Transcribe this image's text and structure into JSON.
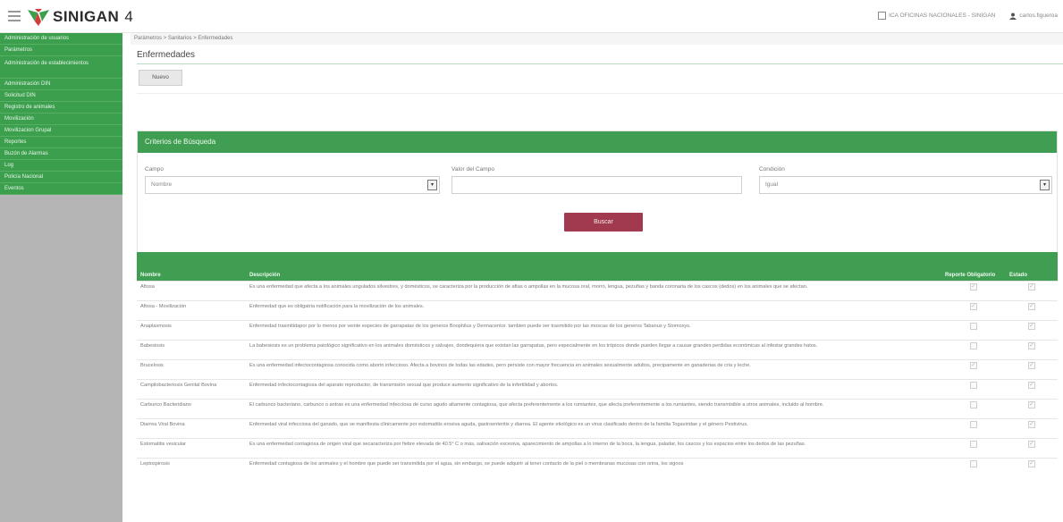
{
  "header": {
    "app_name": "SINIGAN",
    "version": "4",
    "office_label": "ICA OFICINAS NACIONALES - SINIGAN",
    "user_label": "carlos.figueroa"
  },
  "sidebar": {
    "items": [
      {
        "label": "Administración de usuarios"
      },
      {
        "label": "Parámetros"
      },
      {
        "label": "Administración de establecimientos"
      },
      {
        "label": "Administración DIN"
      },
      {
        "label": "Solicitud DIN"
      },
      {
        "label": "Registro de animales"
      },
      {
        "label": "Movilización"
      },
      {
        "label": "Movilizacion Grupal"
      },
      {
        "label": "Reportes"
      },
      {
        "label": "Buzón de Alarmas"
      },
      {
        "label": "Log"
      },
      {
        "label": "Policía Nacional"
      },
      {
        "label": "Eventos"
      }
    ]
  },
  "breadcrumb": "Parámetros > Sanitarios > Enfermedades",
  "page": {
    "title": "Enfermedades",
    "new_button": "Nuevo"
  },
  "criteria": {
    "title": "Criterios de Búsqueda",
    "field_label": "Campo",
    "field_value": "Nombre",
    "value_label": "Valor del Campo",
    "value_value": "",
    "condition_label": "Condición",
    "condition_value": "Igual",
    "search_button": "Buscar"
  },
  "table": {
    "headers": {
      "name": "Nombre",
      "description": "Descripción",
      "mandatory": "Reporte Obligatorio",
      "status": "Estado"
    },
    "rows": [
      {
        "name": "Aftosa",
        "description": "Es una enfermedad que afecta a los animales ungulados silvestres, y domésticos, se caracteriza por la producción de aftas o ampollas en la mucosa oral, morro, lengua, pezuñas y banda coronaria de los cascos (dedos) en los animales que se afectan.",
        "mandatory": true,
        "status": true
      },
      {
        "name": "Aftosa - Movilización",
        "description": "Enfermedad que es obligatria notificación para la movilización de los animales.",
        "mandatory": true,
        "status": true
      },
      {
        "name": "Anaplasmosis",
        "description": "Enfermedad trasmitidapor por lo menos por veinte especies de garrapatas de los generos Boophilus y Dermacentor. tambien puede ser trasmitido por las moscas de los generos Tabanus y Stomoxys.",
        "mandatory": false,
        "status": true
      },
      {
        "name": "Babesiosis",
        "description": "La babesiosis es un problema patológico significativo en los animales domésticos y salvajes, dondequiera que existan las garrapatas, pero especialmente en los trópicos donde pueden llegar a causar grandes perdidas económicas al infestar grandes hatos.",
        "mandatory": false,
        "status": true
      },
      {
        "name": "Brucelosis",
        "description": "Es una enfermedad infectocontagiosa conocida como aborto infeccioso. Afecta a bovinos de todas las edades, pero persiste con mayor frecuencia en animales sexualmente adultos, precipamente en ganaderias de cria y leche.",
        "mandatory": true,
        "status": true
      },
      {
        "name": "Campilobacteriosis Genital Bovina",
        "description": "Enfermedad infectocontagiosa del aparato reproductor, de transmisión sexual que produce aumento significativo de la infertilidad y abortos.",
        "mandatory": false,
        "status": true
      },
      {
        "name": "Carbunco Bacteridiano",
        "description": "El carbunco bacteriano, carbunco o antrax es una enfermedad infecciosa de curso agudo altamente contagiosa, que afecta preferentemente a los rumiantes, que afecta preferentemente a los rumiantes, siendo transmisible a otros animales, incluido al hombre.",
        "mandatory": false,
        "status": true
      },
      {
        "name": "Diarrea Viral Bovina",
        "description": "Enfermedad viral infecciosa del ganado, que se manifiesta clínicamente por estomatitis erosiva aguda, gastroenteritis y diarrea. El agente etiológico es un virus clasificado dentro de la familia Togaviridae y el género Pestivirus.",
        "mandatory": false,
        "status": true
      },
      {
        "name": "Estomatitis vesicular",
        "description": "Es una enfermedad contagiosa de origen viral que secaracteriza por fiebre elevada de 40.5° C o más, salivación excesiva, aparecimiento de ampollas a lo interno de la boca, la lengua, paladar, los cascos y los espacios entre los dedos de las pezuñas.",
        "mandatory": false,
        "status": true
      },
      {
        "name": "Leptospirosis",
        "description": "Enfermedad contagiosa de los animales y el hombre que puede ser transmitida por el agua, sin embargo, se puede adquirir al tener contacto de la piel o membranas mucosas con orina, los signos",
        "mandatory": false,
        "status": true
      }
    ]
  },
  "colors": {
    "accent_green": "#3f9e52",
    "button_red": "#a13a4e",
    "sidebar_gray": "#b5b5b5"
  }
}
